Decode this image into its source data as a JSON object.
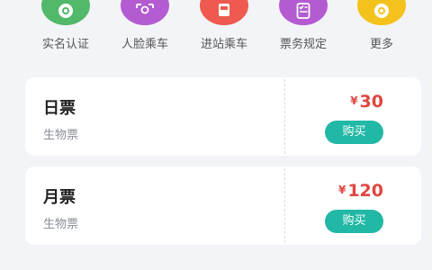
{
  "quick_actions": [
    {
      "label": "实名认证",
      "icon": "gear-icon",
      "color": "#52b96b"
    },
    {
      "label": "人脸乘车",
      "icon": "face-scan-icon",
      "color": "#b45bd2"
    },
    {
      "label": "进站乘车",
      "icon": "train-icon",
      "color": "#ee5a4f"
    },
    {
      "label": "票务规定",
      "icon": "checklist-icon",
      "color": "#b45bd2"
    },
    {
      "label": "更多",
      "icon": "gear-icon",
      "color": "#f4c21c"
    }
  ],
  "tickets": [
    {
      "name": "日票",
      "type": "生物票",
      "currency": "¥",
      "price": "30",
      "buy_label": "购买"
    },
    {
      "name": "月票",
      "type": "生物票",
      "currency": "¥",
      "price": "120",
      "buy_label": "购买"
    }
  ],
  "colors": {
    "background": "#f3f4f8",
    "price": "#e0463f",
    "button": "#22b8a6"
  }
}
